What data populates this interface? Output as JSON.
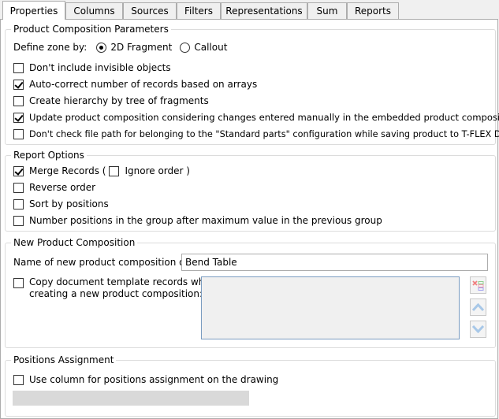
{
  "tabs": [
    {
      "label": "Properties",
      "active": true
    },
    {
      "label": "Columns",
      "active": false
    },
    {
      "label": "Sources",
      "active": false
    },
    {
      "label": "Filters",
      "active": false
    },
    {
      "label": "Representations",
      "active": false
    },
    {
      "label": "Sum",
      "active": false
    },
    {
      "label": "Reports",
      "active": false
    }
  ],
  "product_composition_parameters": {
    "title": "Product Composition Parameters",
    "define_zone_label": "Define zone by:",
    "zone_options": [
      {
        "label": "2D Fragment",
        "selected": true
      },
      {
        "label": "Callout",
        "selected": false
      }
    ],
    "checkboxes": [
      {
        "label": "Don't include invisible objects",
        "checked": false
      },
      {
        "label": "Auto-correct number of records based on arrays",
        "checked": true
      },
      {
        "label": "Create hierarchy by tree of fragments",
        "checked": false
      },
      {
        "label": "Update product composition considering changes entered manually in the embedded product compositions",
        "checked": true
      },
      {
        "label": "Don't check file path for belonging to the \"Standard parts\" configuration while saving product to T-FLEX DOCs",
        "checked": false
      }
    ]
  },
  "report_options": {
    "title": "Report Options",
    "merge_records": {
      "label": "Merge Records (",
      "checked": true
    },
    "ignore_order": {
      "label": "Ignore order )",
      "checked": false
    },
    "checkboxes": [
      {
        "label": "Reverse order",
        "checked": false
      },
      {
        "label": "Sort by positions",
        "checked": false
      },
      {
        "label": "Number positions in the group after maximum value in the previous group",
        "checked": false
      }
    ]
  },
  "new_product_composition": {
    "title": "New Product Composition",
    "name_label": "Name of new product composition on creation:",
    "name_value": "Bend Table",
    "copy_template": {
      "label_line1": "Copy document template records when",
      "label_line2": "creating a new product composition:",
      "checked": false
    },
    "side_buttons": [
      "delete-records-icon",
      "move-up-icon",
      "move-down-icon"
    ]
  },
  "positions_assignment": {
    "title": "Positions Assignment",
    "use_column": {
      "label": "Use column for positions assignment on the drawing",
      "checked": false
    }
  }
}
